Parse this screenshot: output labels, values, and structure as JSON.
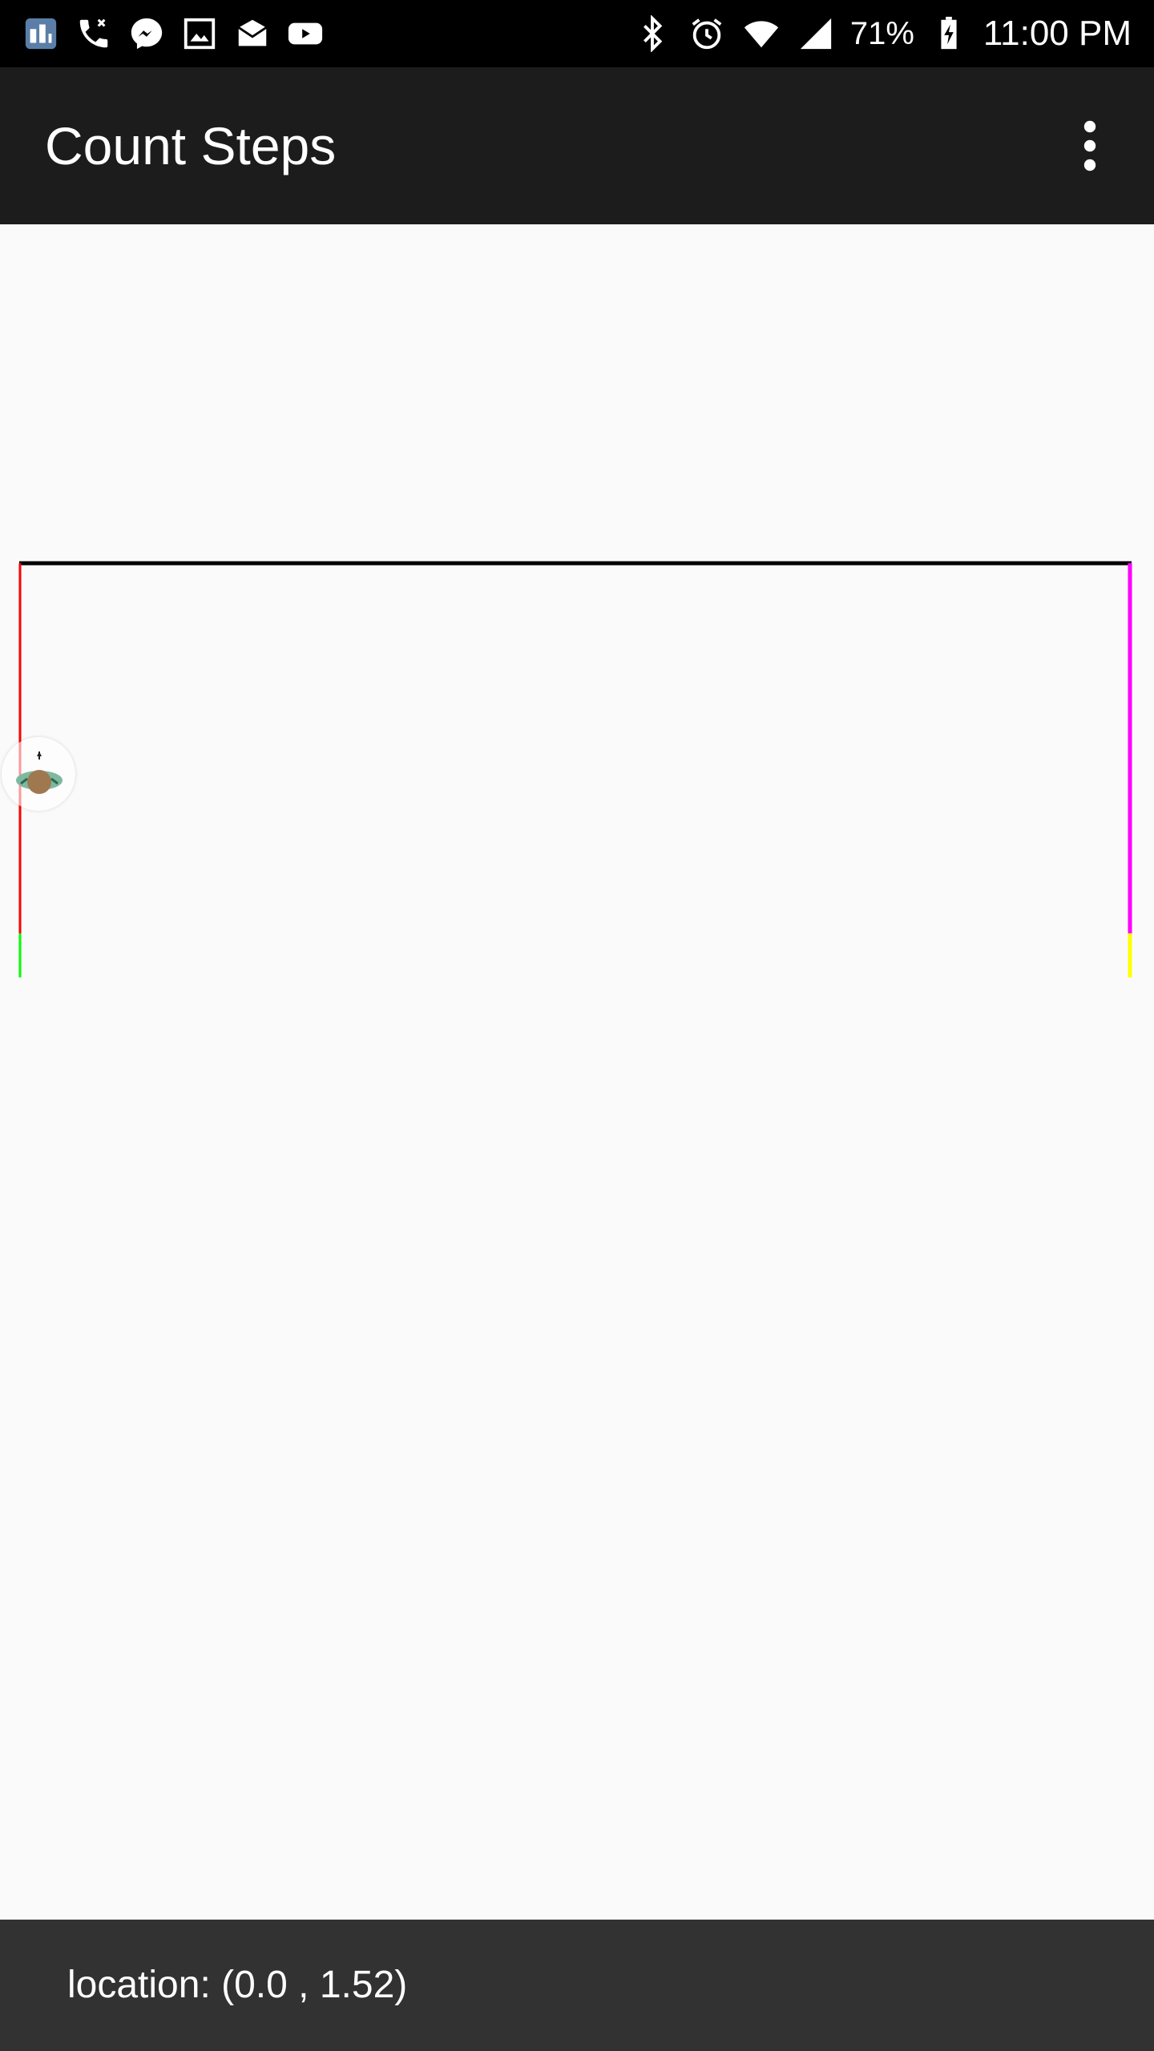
{
  "status_bar": {
    "left_icons": [
      "app-notification-icon",
      "phone-call-icon",
      "messenger-icon",
      "image-icon",
      "mail-icon",
      "youtube-icon"
    ],
    "right_icons": [
      "bluetooth-icon",
      "alarm-icon",
      "wifi-icon",
      "cell-signal-icon",
      "battery-charging-icon"
    ],
    "battery_percent": "71%",
    "time": "11:00 PM"
  },
  "app_bar": {
    "title": "Count Steps",
    "overflow_icon": "more-vert-icon"
  },
  "floor_plan": {
    "colors": {
      "top": "#000000",
      "left_upper": "#ff0000",
      "left_lower": "#00ff00",
      "right_upper": "#ff00ff",
      "right_lower": "#ffff00",
      "bottom": "#0000ff"
    },
    "walker_icon": "person-marker-icon"
  },
  "snackbar": {
    "location_text": "location: (0.0 , 1.52)"
  }
}
